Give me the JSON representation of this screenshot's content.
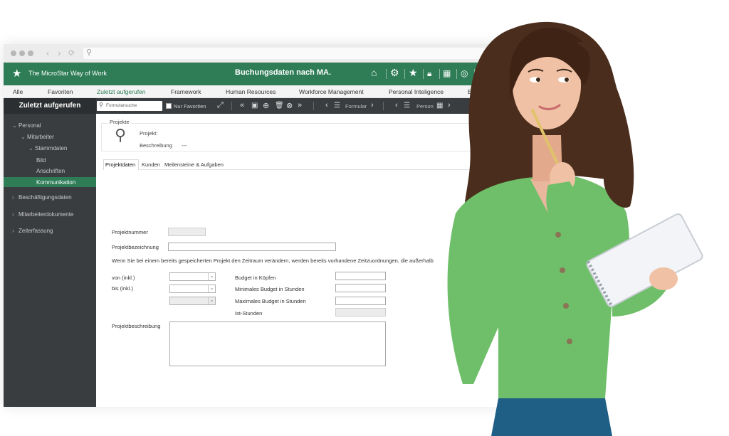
{
  "browser": {
    "address": ""
  },
  "app": {
    "brand": "The MicroStar Way of Work",
    "title": "Buchungsdaten nach MA.",
    "accent_color": "#2e7d57",
    "toolbar_icons": [
      "home-icon",
      "gear-icon",
      "star-icon",
      "lock-icon",
      "calendar-icon",
      "chat-icon",
      "clock-icon"
    ]
  },
  "menu": {
    "items": [
      "Alle",
      "Favoriten",
      "Zuletzt aufgerufen",
      "Framework",
      "Human Resources",
      "Workforce Management",
      "Personal Inteligence",
      "Ente"
    ],
    "active": "Zuletzt aufgerufen"
  },
  "toolbar": {
    "title": "Zuletzt aufgerufen",
    "search_placeholder": "Formularsuche",
    "favorites_only": "Nur Favoriten",
    "formular_label": "Formular",
    "person_label": "Person"
  },
  "sidebar": {
    "items": [
      {
        "label": "Personal",
        "expanded": true
      },
      {
        "label": "Mitarbeiter",
        "expanded": true
      },
      {
        "label": "Stammdaten",
        "expanded": true
      },
      {
        "label": "Bild"
      },
      {
        "label": "Anschriften"
      },
      {
        "label": "Kommunikation",
        "active": true
      },
      {
        "label": "Beschäftigungsdaten",
        "expanded": false
      },
      {
        "label": "Mitarbeiterdokumente",
        "expanded": false
      },
      {
        "label": "Zeiterfassung",
        "expanded": false
      }
    ]
  },
  "project": {
    "box_label": "Projekte",
    "projekt_label": "Projekt:",
    "beschreibung_label": "Beschreibung",
    "beschreibung_value": "---"
  },
  "tabs": [
    "Projektdaten",
    "Kunden",
    "Meilensteine & Aufgaben"
  ],
  "form": {
    "projektnummer": "Projektnummer",
    "projektbezeichnung": "Projektbezeichnung",
    "notice": "Wenn Sie bei einem bereits gespeicherten Projekt den Zeitraum verändern, werden bereits vorhandene Zeitzuordnungen, die außerhalb",
    "von": "von (inkl.)",
    "bis": "bis (inkl.)",
    "budget_koepfe": "Budget in Köpfen",
    "min_budget": "Minimales Budget in Stunden",
    "max_budget": "Maximales Budget in Stunden",
    "ist_stunden": "Ist-Stunden",
    "projektbeschreibung": "Projektbeschreibung"
  }
}
